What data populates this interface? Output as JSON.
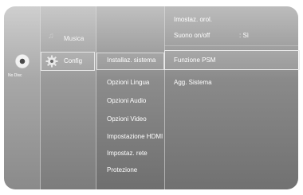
{
  "disc_status": {
    "label": "No Disc",
    "icon": "disc-icon"
  },
  "main_menu": [
    {
      "label": "Musica",
      "icon": "music-icon",
      "selected": false
    },
    {
      "label": "Config",
      "icon": "gear-icon",
      "selected": true
    }
  ],
  "config_menu": [
    {
      "label": "Installaz. sistema",
      "selected": true
    },
    {
      "label": "Opzioni Lingua"
    },
    {
      "label": "Opzioni Audio"
    },
    {
      "label": "Opzioni Video"
    },
    {
      "label": "Impostazione HDMI"
    },
    {
      "label": "Impostaz. rete"
    },
    {
      "label": "Protezione"
    }
  ],
  "system_menu": [
    {
      "label": "Imostaz. orol."
    },
    {
      "label": "Suono on/off",
      "value": ": Sì"
    },
    {
      "label": "Funzione PSM",
      "selected": true
    },
    {
      "label": "Agg. Sistema"
    }
  ],
  "colors": {
    "text": "#ffffff",
    "panel_dark": "#7a7a7a",
    "panel_light": "#c8c8c8"
  }
}
